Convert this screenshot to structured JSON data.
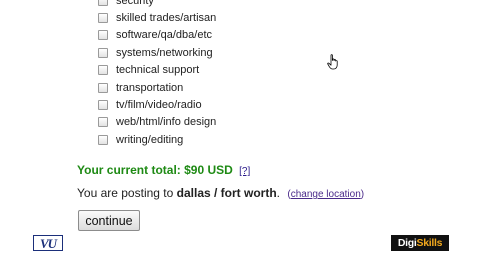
{
  "categories": [
    {
      "label": "security",
      "checked": false
    },
    {
      "label": "skilled trades/artisan",
      "checked": false
    },
    {
      "label": "software/qa/dba/etc",
      "checked": false
    },
    {
      "label": "systems/networking",
      "checked": false
    },
    {
      "label": "technical support",
      "checked": false
    },
    {
      "label": "transportation",
      "checked": false
    },
    {
      "label": "tv/film/video/radio",
      "checked": false
    },
    {
      "label": "web/html/info design",
      "checked": false
    },
    {
      "label": "writing/editing",
      "checked": false
    }
  ],
  "total": {
    "text": "Your current total: $90 USD",
    "help_link": "[?]",
    "color": "#1e8a14"
  },
  "posting": {
    "prefix": "You are posting to",
    "city": "dallas / fort worth",
    "suffix": ".",
    "open_paren": "(",
    "change_link": "change location",
    "close_paren": ")"
  },
  "continue_label": "continue",
  "logos": {
    "left": "VU",
    "right_part1": "Digi",
    "right_part2": "Skills",
    "right_accent": "#f2a81d"
  },
  "cursor_icon": "hand-pointer-icon"
}
